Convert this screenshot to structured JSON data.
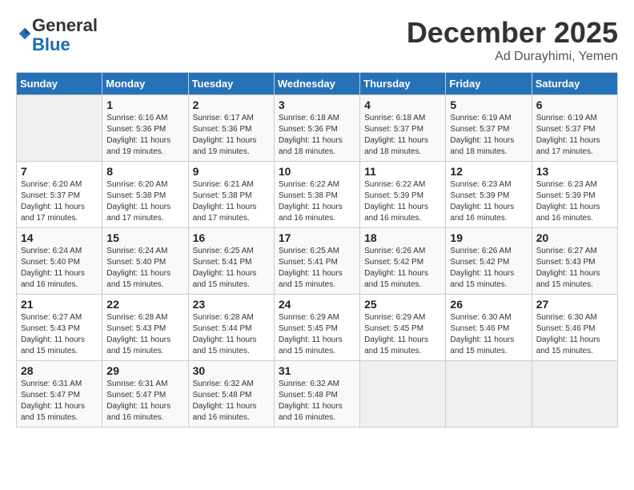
{
  "logo": {
    "general": "General",
    "blue": "Blue"
  },
  "header": {
    "month": "December 2025",
    "location": "Ad Durayhimi, Yemen"
  },
  "weekdays": [
    "Sunday",
    "Monday",
    "Tuesday",
    "Wednesday",
    "Thursday",
    "Friday",
    "Saturday"
  ],
  "weeks": [
    [
      {
        "day": "",
        "sunrise": "",
        "sunset": "",
        "daylight": ""
      },
      {
        "day": "1",
        "sunrise": "Sunrise: 6:16 AM",
        "sunset": "Sunset: 5:36 PM",
        "daylight": "Daylight: 11 hours and 19 minutes."
      },
      {
        "day": "2",
        "sunrise": "Sunrise: 6:17 AM",
        "sunset": "Sunset: 5:36 PM",
        "daylight": "Daylight: 11 hours and 19 minutes."
      },
      {
        "day": "3",
        "sunrise": "Sunrise: 6:18 AM",
        "sunset": "Sunset: 5:36 PM",
        "daylight": "Daylight: 11 hours and 18 minutes."
      },
      {
        "day": "4",
        "sunrise": "Sunrise: 6:18 AM",
        "sunset": "Sunset: 5:37 PM",
        "daylight": "Daylight: 11 hours and 18 minutes."
      },
      {
        "day": "5",
        "sunrise": "Sunrise: 6:19 AM",
        "sunset": "Sunset: 5:37 PM",
        "daylight": "Daylight: 11 hours and 18 minutes."
      },
      {
        "day": "6",
        "sunrise": "Sunrise: 6:19 AM",
        "sunset": "Sunset: 5:37 PM",
        "daylight": "Daylight: 11 hours and 17 minutes."
      }
    ],
    [
      {
        "day": "7",
        "sunrise": "Sunrise: 6:20 AM",
        "sunset": "Sunset: 5:37 PM",
        "daylight": "Daylight: 11 hours and 17 minutes."
      },
      {
        "day": "8",
        "sunrise": "Sunrise: 6:20 AM",
        "sunset": "Sunset: 5:38 PM",
        "daylight": "Daylight: 11 hours and 17 minutes."
      },
      {
        "day": "9",
        "sunrise": "Sunrise: 6:21 AM",
        "sunset": "Sunset: 5:38 PM",
        "daylight": "Daylight: 11 hours and 17 minutes."
      },
      {
        "day": "10",
        "sunrise": "Sunrise: 6:22 AM",
        "sunset": "Sunset: 5:38 PM",
        "daylight": "Daylight: 11 hours and 16 minutes."
      },
      {
        "day": "11",
        "sunrise": "Sunrise: 6:22 AM",
        "sunset": "Sunset: 5:39 PM",
        "daylight": "Daylight: 11 hours and 16 minutes."
      },
      {
        "day": "12",
        "sunrise": "Sunrise: 6:23 AM",
        "sunset": "Sunset: 5:39 PM",
        "daylight": "Daylight: 11 hours and 16 minutes."
      },
      {
        "day": "13",
        "sunrise": "Sunrise: 6:23 AM",
        "sunset": "Sunset: 5:39 PM",
        "daylight": "Daylight: 11 hours and 16 minutes."
      }
    ],
    [
      {
        "day": "14",
        "sunrise": "Sunrise: 6:24 AM",
        "sunset": "Sunset: 5:40 PM",
        "daylight": "Daylight: 11 hours and 16 minutes."
      },
      {
        "day": "15",
        "sunrise": "Sunrise: 6:24 AM",
        "sunset": "Sunset: 5:40 PM",
        "daylight": "Daylight: 11 hours and 15 minutes."
      },
      {
        "day": "16",
        "sunrise": "Sunrise: 6:25 AM",
        "sunset": "Sunset: 5:41 PM",
        "daylight": "Daylight: 11 hours and 15 minutes."
      },
      {
        "day": "17",
        "sunrise": "Sunrise: 6:25 AM",
        "sunset": "Sunset: 5:41 PM",
        "daylight": "Daylight: 11 hours and 15 minutes."
      },
      {
        "day": "18",
        "sunrise": "Sunrise: 6:26 AM",
        "sunset": "Sunset: 5:42 PM",
        "daylight": "Daylight: 11 hours and 15 minutes."
      },
      {
        "day": "19",
        "sunrise": "Sunrise: 6:26 AM",
        "sunset": "Sunset: 5:42 PM",
        "daylight": "Daylight: 11 hours and 15 minutes."
      },
      {
        "day": "20",
        "sunrise": "Sunrise: 6:27 AM",
        "sunset": "Sunset: 5:43 PM",
        "daylight": "Daylight: 11 hours and 15 minutes."
      }
    ],
    [
      {
        "day": "21",
        "sunrise": "Sunrise: 6:27 AM",
        "sunset": "Sunset: 5:43 PM",
        "daylight": "Daylight: 11 hours and 15 minutes."
      },
      {
        "day": "22",
        "sunrise": "Sunrise: 6:28 AM",
        "sunset": "Sunset: 5:43 PM",
        "daylight": "Daylight: 11 hours and 15 minutes."
      },
      {
        "day": "23",
        "sunrise": "Sunrise: 6:28 AM",
        "sunset": "Sunset: 5:44 PM",
        "daylight": "Daylight: 11 hours and 15 minutes."
      },
      {
        "day": "24",
        "sunrise": "Sunrise: 6:29 AM",
        "sunset": "Sunset: 5:45 PM",
        "daylight": "Daylight: 11 hours and 15 minutes."
      },
      {
        "day": "25",
        "sunrise": "Sunrise: 6:29 AM",
        "sunset": "Sunset: 5:45 PM",
        "daylight": "Daylight: 11 hours and 15 minutes."
      },
      {
        "day": "26",
        "sunrise": "Sunrise: 6:30 AM",
        "sunset": "Sunset: 5:46 PM",
        "daylight": "Daylight: 11 hours and 15 minutes."
      },
      {
        "day": "27",
        "sunrise": "Sunrise: 6:30 AM",
        "sunset": "Sunset: 5:46 PM",
        "daylight": "Daylight: 11 hours and 15 minutes."
      }
    ],
    [
      {
        "day": "28",
        "sunrise": "Sunrise: 6:31 AM",
        "sunset": "Sunset: 5:47 PM",
        "daylight": "Daylight: 11 hours and 15 minutes."
      },
      {
        "day": "29",
        "sunrise": "Sunrise: 6:31 AM",
        "sunset": "Sunset: 5:47 PM",
        "daylight": "Daylight: 11 hours and 16 minutes."
      },
      {
        "day": "30",
        "sunrise": "Sunrise: 6:32 AM",
        "sunset": "Sunset: 5:48 PM",
        "daylight": "Daylight: 11 hours and 16 minutes."
      },
      {
        "day": "31",
        "sunrise": "Sunrise: 6:32 AM",
        "sunset": "Sunset: 5:48 PM",
        "daylight": "Daylight: 11 hours and 16 minutes."
      },
      {
        "day": "",
        "sunrise": "",
        "sunset": "",
        "daylight": ""
      },
      {
        "day": "",
        "sunrise": "",
        "sunset": "",
        "daylight": ""
      },
      {
        "day": "",
        "sunrise": "",
        "sunset": "",
        "daylight": ""
      }
    ]
  ]
}
